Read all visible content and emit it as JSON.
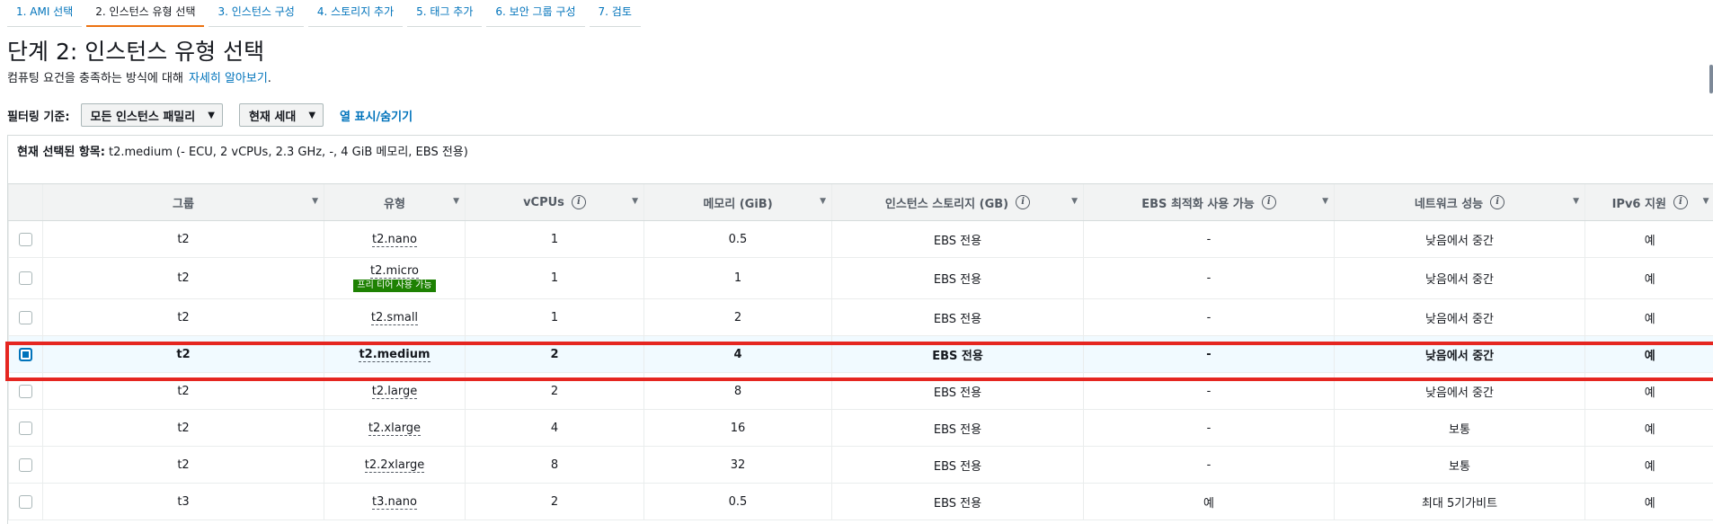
{
  "steps": [
    {
      "label": "1. AMI 선택"
    },
    {
      "label": "2. 인스턴스 유형 선택"
    },
    {
      "label": "3. 인스턴스 구성"
    },
    {
      "label": "4. 스토리지 추가"
    },
    {
      "label": "5. 태그 추가"
    },
    {
      "label": "6. 보안 그룹 구성"
    },
    {
      "label": "7. 검토"
    }
  ],
  "page": {
    "title": "단계 2: 인스턴스 유형 선택",
    "subtitle_text": "컴퓨팅 요건을 충족하는 방식에 대해",
    "subtitle_link": "자세히 알아보기",
    "subtitle_end": "."
  },
  "filter": {
    "label": "필터링 기준:",
    "family_select": "모든 인스턴스 패밀리",
    "generation_select": "현재 세대",
    "toggle_columns": "열 표시/숨기기"
  },
  "selected_summary": {
    "label": "현재 선택된 항목:",
    "value": "t2.medium (- ECU, 2 vCPUs, 2.3 GHz, -, 4 GiB 메모리, EBS 전용)"
  },
  "columns": [
    "그룹",
    "유형",
    "vCPUs",
    "메모리 (GiB)",
    "인스턴스 스토리지 (GB)",
    "EBS 최적화 사용 가능",
    "네트워크 성능",
    "IPv6 지원"
  ],
  "rows": [
    {
      "group": "t2",
      "type": "t2.nano",
      "vcpus": "1",
      "memory": "0.5",
      "storage": "EBS 전용",
      "ebs": "-",
      "network": "낮음에서 중간",
      "ipv6": "예"
    },
    {
      "group": "t2",
      "type": "t2.micro",
      "badge": "프리 티어 사용 가능",
      "vcpus": "1",
      "memory": "1",
      "storage": "EBS 전용",
      "ebs": "-",
      "network": "낮음에서 중간",
      "ipv6": "예"
    },
    {
      "group": "t2",
      "type": "t2.small",
      "vcpus": "1",
      "memory": "2",
      "storage": "EBS 전용",
      "ebs": "-",
      "network": "낮음에서 중간",
      "ipv6": "예"
    },
    {
      "group": "t2",
      "type": "t2.medium",
      "vcpus": "2",
      "memory": "4",
      "storage": "EBS 전용",
      "ebs": "-",
      "network": "낮음에서 중간",
      "ipv6": "예",
      "selected": true
    },
    {
      "group": "t2",
      "type": "t2.large",
      "vcpus": "2",
      "memory": "8",
      "storage": "EBS 전용",
      "ebs": "-",
      "network": "낮음에서 중간",
      "ipv6": "예"
    },
    {
      "group": "t2",
      "type": "t2.xlarge",
      "vcpus": "4",
      "memory": "16",
      "storage": "EBS 전용",
      "ebs": "-",
      "network": "보통",
      "ipv6": "예"
    },
    {
      "group": "t2",
      "type": "t2.2xlarge",
      "vcpus": "8",
      "memory": "32",
      "storage": "EBS 전용",
      "ebs": "-",
      "network": "보통",
      "ipv6": "예"
    },
    {
      "group": "t3",
      "type": "t3.nano",
      "vcpus": "2",
      "memory": "0.5",
      "storage": "EBS 전용",
      "ebs": "예",
      "network": "최대 5기가비트",
      "ipv6": "예"
    }
  ]
}
